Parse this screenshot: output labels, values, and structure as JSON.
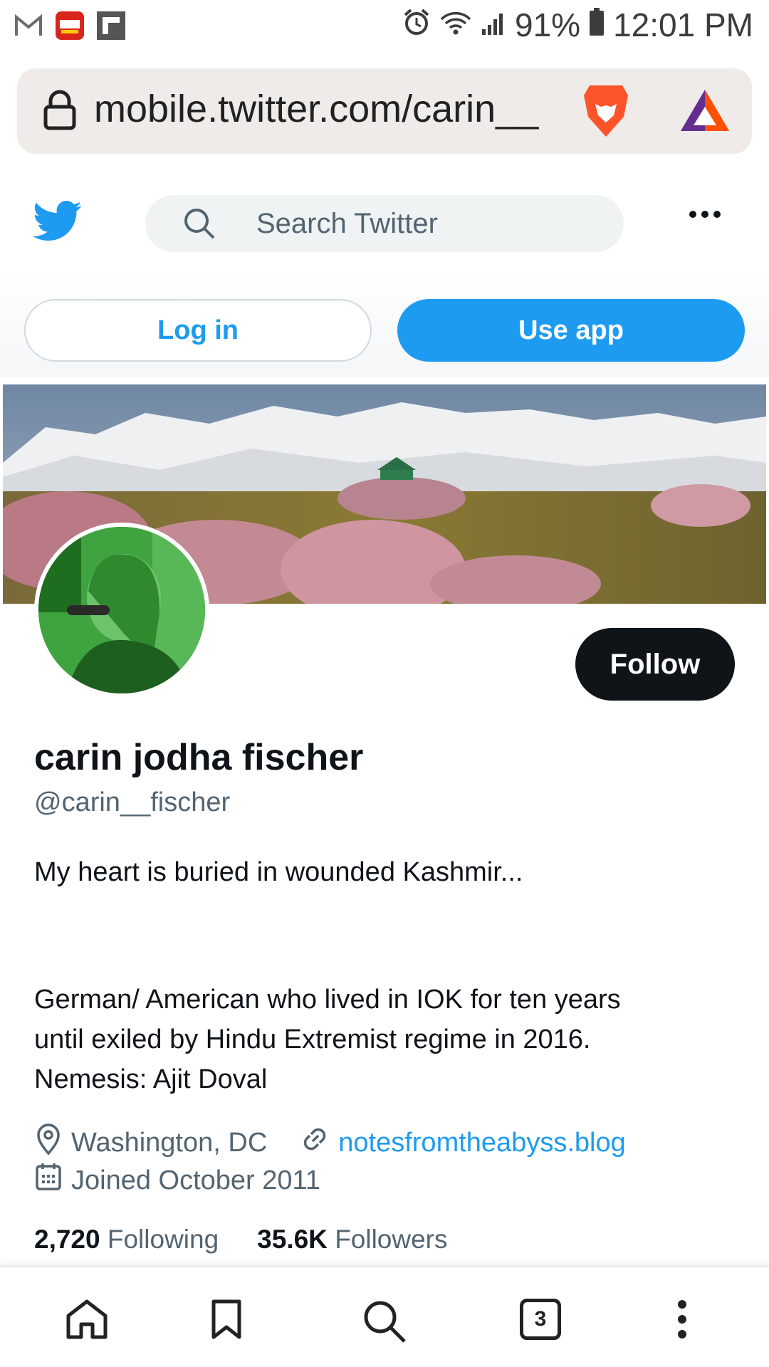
{
  "status_bar": {
    "battery": "91%",
    "time": "12:01 PM",
    "app_icons": [
      "gmail-icon",
      "marathi-news-icon",
      "flipboard-icon"
    ]
  },
  "browser": {
    "url": "mobile.twitter.com/carin__"
  },
  "twitter": {
    "search_placeholder": "Search Twitter",
    "login_label": "Log in",
    "use_app_label": "Use app",
    "follow_label": "Follow"
  },
  "profile": {
    "name": "carin jodha fischer",
    "handle": "@carin__fischer",
    "bio_line1": "My heart is buried in wounded Kashmir...",
    "bio_line2": "German/ American who lived in IOK for ten years\nuntil exiled by Hindu Extremist regime in 2016.\nNemesis: Ajit Doval",
    "location": "Washington, DC",
    "website": "notesfromtheabyss.blog",
    "joined": "Joined October 2011",
    "following_count": "2,720",
    "following_label": "Following",
    "followers_count": "35.6K",
    "followers_label": "Followers"
  },
  "bottom_nav": {
    "tab_count": "3"
  },
  "colors": {
    "twitter_blue": "#1d9bf0",
    "text_primary": "#0f1419",
    "text_secondary": "#536471"
  }
}
